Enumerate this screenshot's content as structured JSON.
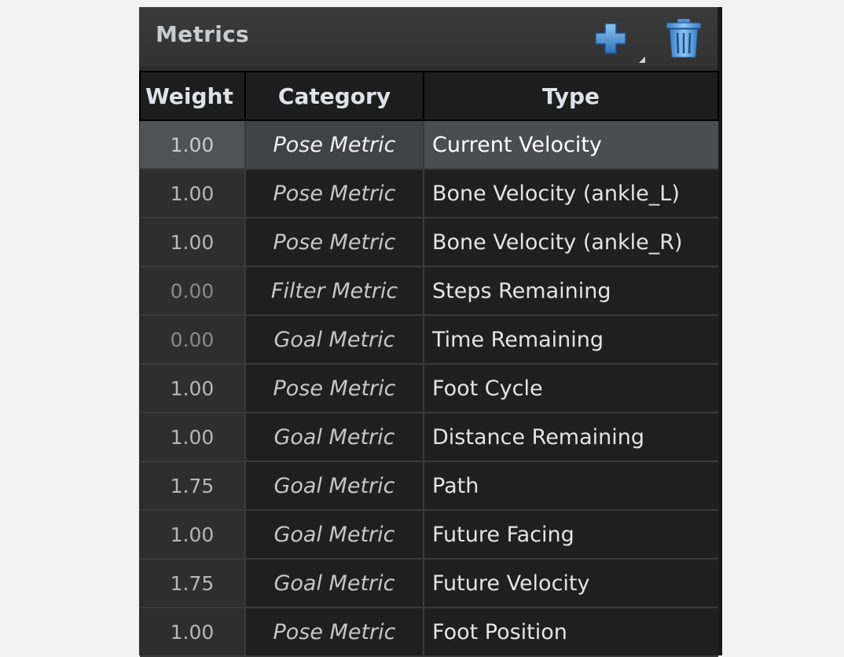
{
  "panel": {
    "title": "Metrics",
    "add_icon": "plus-icon",
    "delete_icon": "trash-icon"
  },
  "table": {
    "headers": [
      "Weight",
      "Category",
      "Type"
    ],
    "rows": [
      {
        "weight": "1.00",
        "category": "Pose Metric",
        "type": "Current Velocity",
        "selected": true
      },
      {
        "weight": "1.00",
        "category": "Pose Metric",
        "type": "Bone Velocity (ankle_L)"
      },
      {
        "weight": "1.00",
        "category": "Pose Metric",
        "type": "Bone Velocity (ankle_R)"
      },
      {
        "weight": "0.00",
        "category": "Filter Metric",
        "type": "Steps Remaining"
      },
      {
        "weight": "0.00",
        "category": "Goal Metric",
        "type": "Time Remaining"
      },
      {
        "weight": "1.00",
        "category": "Pose Metric",
        "type": "Foot Cycle"
      },
      {
        "weight": "1.00",
        "category": "Goal Metric",
        "type": "Distance Remaining"
      },
      {
        "weight": "1.75",
        "category": "Goal Metric",
        "type": "Path"
      },
      {
        "weight": "1.00",
        "category": "Goal Metric",
        "type": "Future Facing"
      },
      {
        "weight": "1.75",
        "category": "Goal Metric",
        "type": "Future Velocity"
      },
      {
        "weight": "1.00",
        "category": "Pose Metric",
        "type": "Foot Position"
      }
    ]
  },
  "colors": {
    "panel_bg": "#2d2d2d",
    "selected_row": "#4a4d52",
    "add_icon": "#4a8fd6",
    "trash_icon": "#5aa0e0"
  }
}
